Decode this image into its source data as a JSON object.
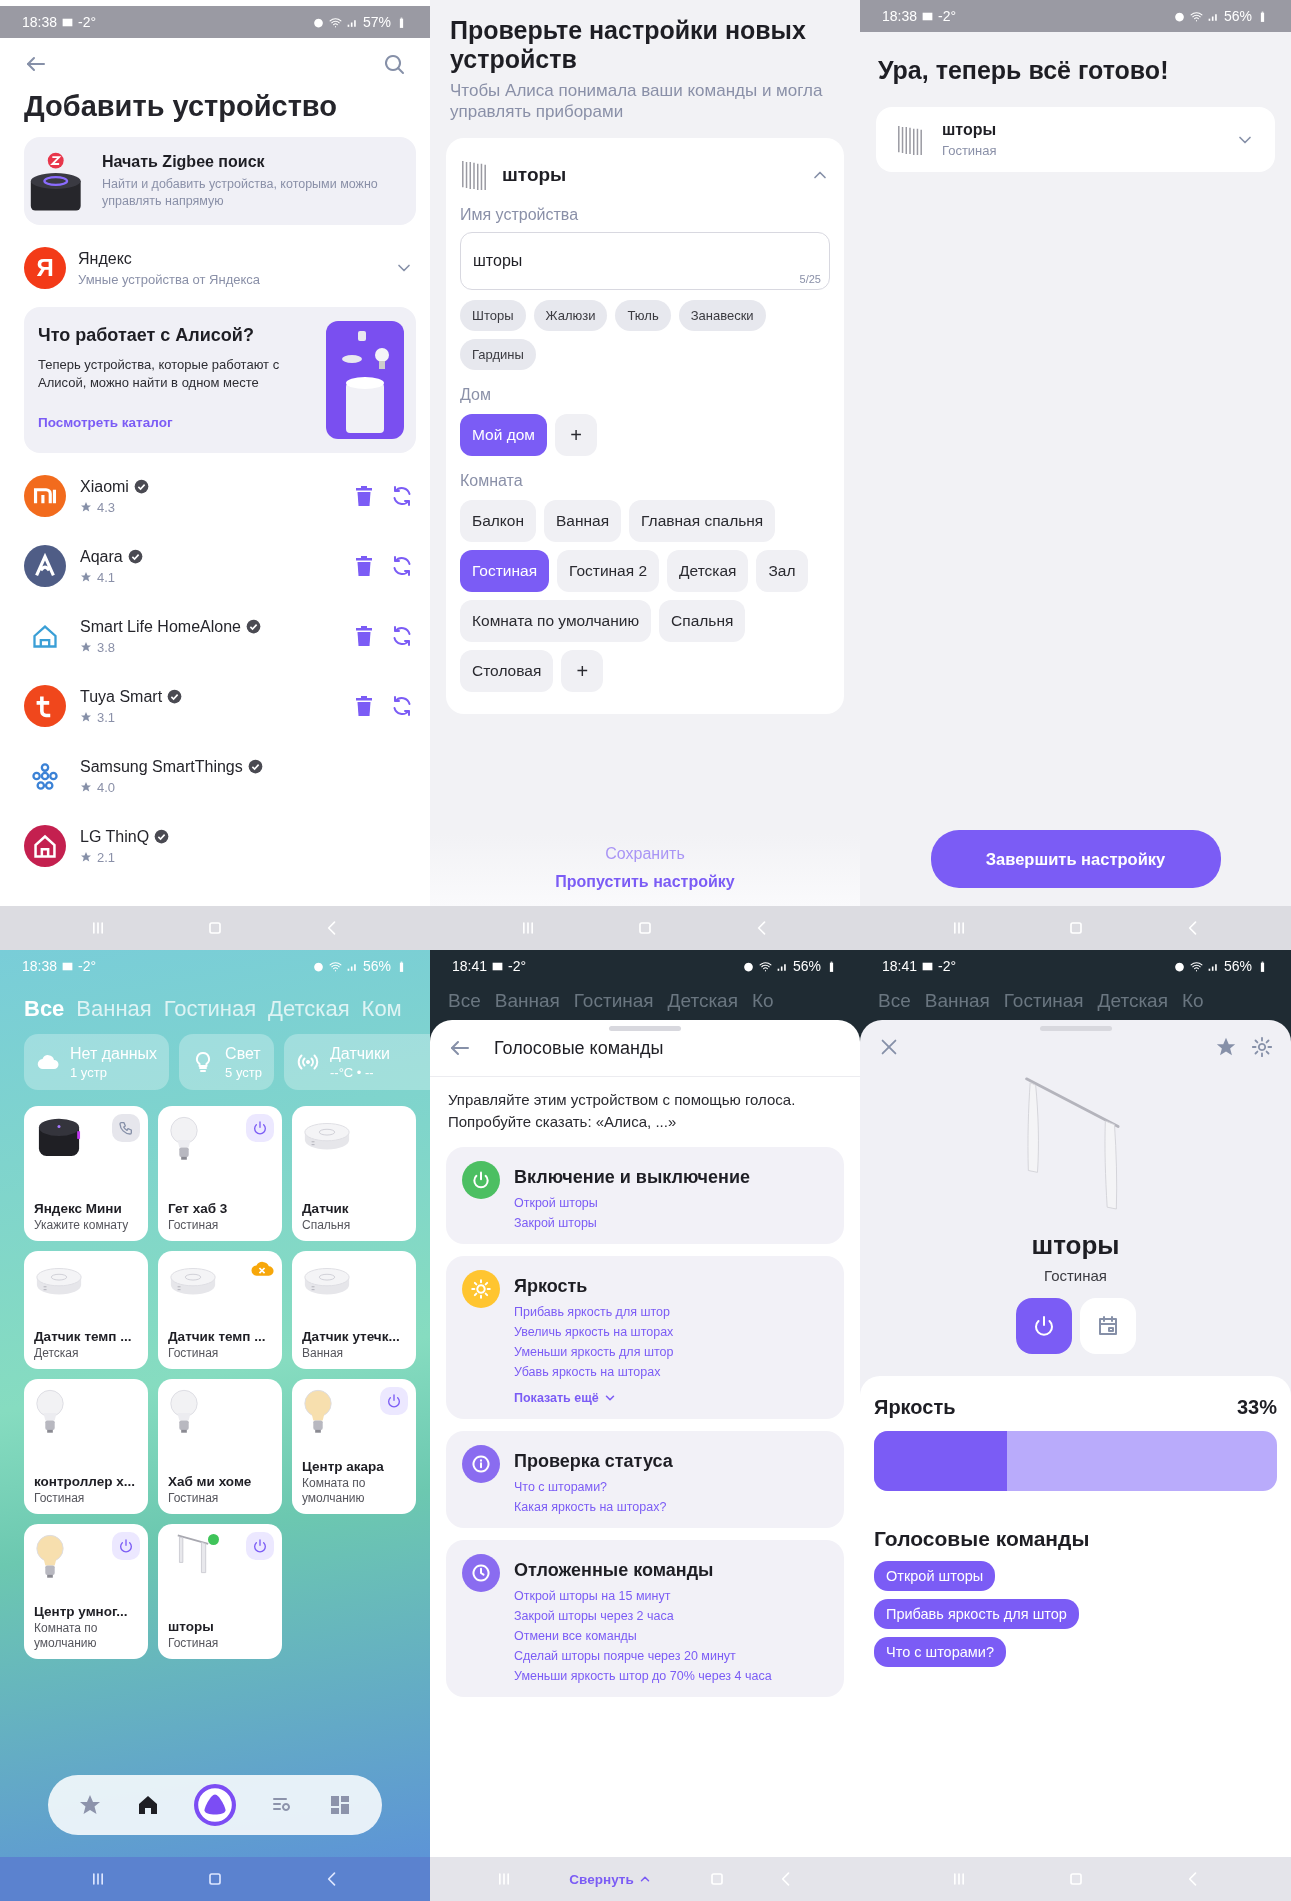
{
  "add_device": {
    "status_bar": {
      "time": "18:38",
      "temperature": "-2°",
      "battery": "57%"
    },
    "title": "Добавить устройство",
    "zigbee": {
      "title": "Начать Zigbee поиск",
      "description": "Найти и добавить устройства, которыми можно управлять напрямую"
    },
    "yandex": {
      "logo": "Я",
      "name": "Яндекс",
      "subtitle": "Умные устройства от Яндекса",
      "expanded": false
    },
    "catalog": {
      "title": "Что работает с Алисой?",
      "text": "Теперь устройства, которые работают с Алисой, можно найти в одном месте",
      "link": "Посмотреть каталог"
    },
    "providers": [
      {
        "kind": "mi",
        "name": "Xiaomi",
        "rating": "4.3",
        "color": "#f26b1d",
        "verified": true,
        "connected": true
      },
      {
        "kind": "aqara",
        "name": "Aqara",
        "rating": "4.1",
        "color": "#4f5d86",
        "verified": true,
        "connected": true
      },
      {
        "kind": "smartlife",
        "name": "Smart Life HomeAlone",
        "rating": "3.8",
        "color": "#3a9fd6",
        "verified": true,
        "connected": true
      },
      {
        "kind": "tuya",
        "name": "Tuya Smart",
        "rating": "3.1",
        "color": "#f0471c",
        "verified": true,
        "connected": true
      },
      {
        "kind": "smartthings",
        "name": "Samsung SmartThings",
        "rating": "4.0",
        "color": "#3b82d6",
        "verified": true,
        "connected": false
      },
      {
        "kind": "lg",
        "name": "LG ThinQ",
        "rating": "2.1",
        "color": "#c4204f",
        "verified": true,
        "connected": false
      }
    ]
  },
  "check_settings": {
    "title": "Проверьте настройки новых устройств",
    "subtitle": "Чтобы Алиса понимала ваши команды и могла управлять приборами",
    "device": {
      "name": "шторы",
      "expanded": true,
      "name_label": "Имя устройства",
      "name_value": "шторы",
      "counter": "5/25",
      "suggestions": [
        "Шторы",
        "Жалюзи",
        "Тюль",
        "Занавески",
        "Гардины"
      ],
      "home_label": "Дом",
      "homes": [
        {
          "label": "Мой дом",
          "selected": true
        }
      ],
      "add_home": "+",
      "room_label": "Комната",
      "rooms": [
        {
          "label": "Балкон",
          "selected": false
        },
        {
          "label": "Ванная",
          "selected": false
        },
        {
          "label": "Главная спальня",
          "selected": false
        },
        {
          "label": "Гостиная",
          "selected": true
        },
        {
          "label": "Гостиная 2",
          "selected": false
        },
        {
          "label": "Детская",
          "selected": false
        },
        {
          "label": "Зал",
          "selected": false
        },
        {
          "label": "Комната по умолчанию",
          "selected": false
        },
        {
          "label": "Спальня",
          "selected": false
        },
        {
          "label": "Столовая",
          "selected": false
        }
      ],
      "add_room": "+"
    },
    "buttons": [
      {
        "label": "Сохранить",
        "disabled": true
      },
      {
        "label": "Пропустить настройку",
        "disabled": false
      }
    ]
  },
  "done": {
    "status_bar": {
      "time": "18:38",
      "temperature": "-2°",
      "battery": "56%"
    },
    "title": "Ура, теперь всё готово!",
    "device": {
      "name": "шторы",
      "room": "Гостиная",
      "expanded": false
    },
    "finish_button": "Завершить настройку"
  },
  "home": {
    "status_bar": {
      "time": "18:38",
      "temperature": "-2°",
      "battery": "56%"
    },
    "tabs": [
      {
        "label": "Все",
        "selected": true
      },
      {
        "label": "Ванная",
        "selected": false
      },
      {
        "label": "Гостиная",
        "selected": false
      },
      {
        "label": "Детская",
        "selected": false
      },
      {
        "label": "Ком",
        "selected": false
      }
    ],
    "summary": [
      {
        "kind": "cloud",
        "title": "Нет данных",
        "subtitle": "1 устр"
      },
      {
        "kind": "light",
        "title": "Свет",
        "subtitle": "5 устр"
      },
      {
        "kind": "sensor",
        "title": "Датчики",
        "subtitle": "--°C • --"
      }
    ],
    "devices": [
      {
        "kind": "speaker",
        "name": "Яндекс Мини",
        "room": "Укажите комнату",
        "call_button": true,
        "power_button": false,
        "offline": false,
        "online": false
      },
      {
        "kind": "bulb",
        "name": "Гет хаб 3",
        "room": "Гостиная",
        "call_button": false,
        "power_button": true,
        "offline": false,
        "online": false
      },
      {
        "kind": "sensor",
        "name": "Датчик",
        "room": "Спальня",
        "call_button": false,
        "power_button": false,
        "offline": false,
        "online": false
      },
      {
        "kind": "sensor",
        "name": "Датчик темп ...",
        "room": "Детская",
        "call_button": false,
        "power_button": false,
        "offline": false,
        "online": false
      },
      {
        "kind": "sensor",
        "name": "Датчик темп ...",
        "room": "Гостиная",
        "call_button": false,
        "power_button": false,
        "offline": true,
        "online": false
      },
      {
        "kind": "sensor",
        "name": "Датчик утечк...",
        "room": "Ванная",
        "call_button": false,
        "power_button": false,
        "offline": false,
        "online": false
      },
      {
        "kind": "bulb",
        "name": "контроллер х...",
        "room": "Гостиная",
        "call_button": false,
        "power_button": false,
        "offline": false,
        "online": false
      },
      {
        "kind": "bulb",
        "name": "Хаб ми хоме",
        "room": "Гостиная",
        "call_button": false,
        "power_button": false,
        "offline": false,
        "online": false
      },
      {
        "kind": "warm_bulb",
        "name": "Центр акара",
        "room": "Комната по умолчанию",
        "call_button": false,
        "power_button": true,
        "offline": false,
        "online": false
      },
      {
        "kind": "warm_bulb",
        "name": "Центр умног...",
        "room": "Комната по умолчанию",
        "call_button": false,
        "power_button": true,
        "offline": false,
        "online": false
      },
      {
        "kind": "curtain",
        "name": "шторы",
        "room": "Гостиная",
        "call_button": false,
        "power_button": true,
        "offline": false,
        "online": true
      }
    ],
    "nav": [
      {
        "kind": "favorites",
        "selected": false
      },
      {
        "kind": "home",
        "selected": true
      },
      {
        "kind": "alice",
        "selected": false
      },
      {
        "kind": "feed",
        "selected": false
      },
      {
        "kind": "dashboard",
        "selected": false
      }
    ]
  },
  "voice_commands": {
    "status_bar": {
      "time": "18:41",
      "temperature": "-2°",
      "battery": "56%"
    },
    "backdrop_tabs": [
      "Все",
      "Ванная",
      "Гостиная",
      "Детская",
      "Ко"
    ],
    "title": "Голосовые команды",
    "intro": "Управляйте этим устройством с помощью голоса. Попробуйте сказать: «Алиса, ...»",
    "groups": [
      {
        "kind": "power",
        "title": "Включение и выключение",
        "commands": [
          "Открой шторы",
          "Закрой шторы"
        ]
      },
      {
        "kind": "brightness",
        "title": "Яркость",
        "commands": [
          "Прибавь яркость для штор",
          "Увеличь яркость на шторах",
          "Уменьши яркость для штор",
          "Убавь яркость на шторах"
        ],
        "more": "Показать ещё"
      },
      {
        "kind": "status",
        "title": "Проверка статуса",
        "commands": [
          "Что с шторами?",
          "Какая яркость на шторах?"
        ]
      },
      {
        "kind": "delayed",
        "title": "Отложенные команды",
        "commands": [
          "Открой шторы на 15 минут",
          "Закрой шторы через 2 часа",
          "Отмени все команды",
          "Сделай шторы поярче через 20 минут",
          "Уменьши яркость штор до 70% через 4 часа"
        ]
      }
    ],
    "collapse": "Свернуть"
  },
  "device_card": {
    "status_bar": {
      "time": "18:41",
      "temperature": "-2°",
      "battery": "56%"
    },
    "backdrop_tabs": [
      "Все",
      "Ванная",
      "Гостиная",
      "Детская",
      "Ко"
    ],
    "name": "шторы",
    "room": "Гостиная",
    "controls": [
      {
        "kind": "power",
        "on": true
      },
      {
        "kind": "schedule",
        "on": false
      }
    ],
    "brightness": {
      "label": "Яркость",
      "reading": "33%",
      "level": 0.33
    },
    "voice_title": "Голосовые команды",
    "voice_commands": [
      "Открой шторы",
      "Прибавь яркость для штор",
      "Что с шторами?"
    ]
  }
}
